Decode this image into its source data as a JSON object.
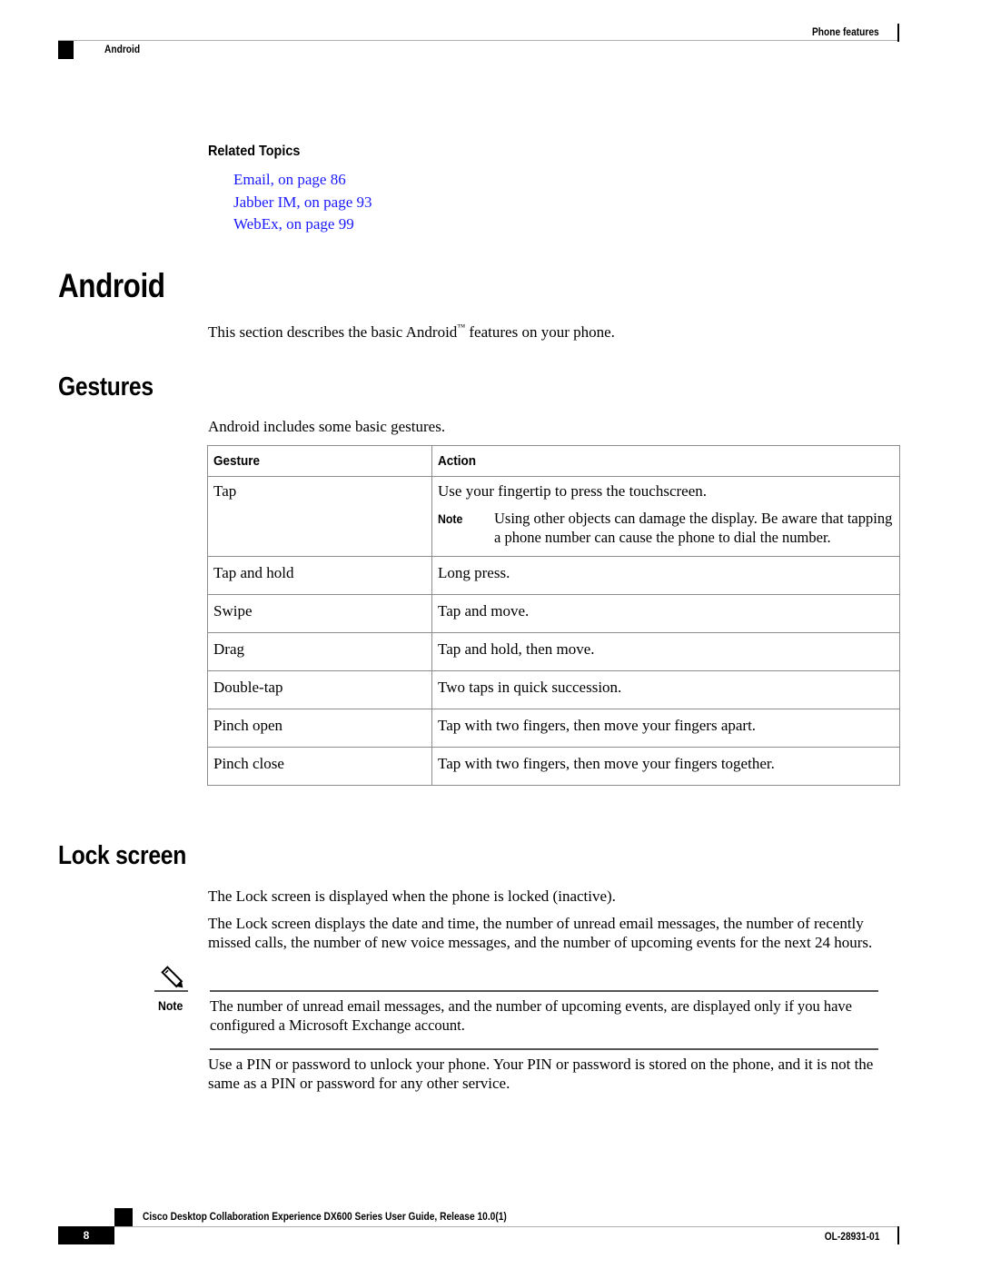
{
  "header": {
    "chapter": "Phone features",
    "section": "Android"
  },
  "related_topics": {
    "title": "Related Topics",
    "links": [
      {
        "label": "Email,  on page 86"
      },
      {
        "label": "Jabber IM,  on page 93"
      },
      {
        "label": "WebEx,  on page 99"
      }
    ]
  },
  "android": {
    "heading": "Android",
    "intro_before": "This section describes the basic Android",
    "trademark": "™",
    "intro_after": " features on your phone."
  },
  "gestures": {
    "heading": "Gestures",
    "intro": "Android includes some basic gestures.",
    "table": {
      "headers": [
        "Gesture",
        "Action"
      ],
      "rows": [
        {
          "gesture": "Tap",
          "action": "Use your fingertip to press the touchscreen.",
          "note_label": "Note",
          "note": "Using other objects can damage the display. Be aware that tapping a phone number can cause the phone to dial the number."
        },
        {
          "gesture": "Tap and hold",
          "action": "Long press."
        },
        {
          "gesture": "Swipe",
          "action": "Tap and move."
        },
        {
          "gesture": "Drag",
          "action": "Tap and hold, then move."
        },
        {
          "gesture": "Double-tap",
          "action": "Two taps in quick succession."
        },
        {
          "gesture": "Pinch open",
          "action": "Tap with two fingers, then move your fingers apart."
        },
        {
          "gesture": "Pinch close",
          "action": "Tap with two fingers, then move your fingers together."
        }
      ]
    }
  },
  "lock_screen": {
    "heading": "Lock screen",
    "para1": "The Lock screen is displayed when the phone is locked (inactive).",
    "para2": "The Lock screen displays the date and time, the number of unread email messages, the number of recently missed calls, the number of new voice messages, and the number of upcoming events for the next 24 hours.",
    "note": {
      "icon": "pencil-icon",
      "label": "Note",
      "text": "The number of unread email messages, and the number of upcoming events, are displayed only if you have configured a Microsoft Exchange account."
    },
    "para3": "Use a PIN or password to unlock your phone. Your PIN or password is stored on the phone, and it is not the same as a PIN or password for any other service."
  },
  "footer": {
    "title": "Cisco Desktop Collaboration Experience DX600 Series User Guide, Release 10.0(1)",
    "page_number": "8",
    "doc_id": "OL-28931-01"
  }
}
